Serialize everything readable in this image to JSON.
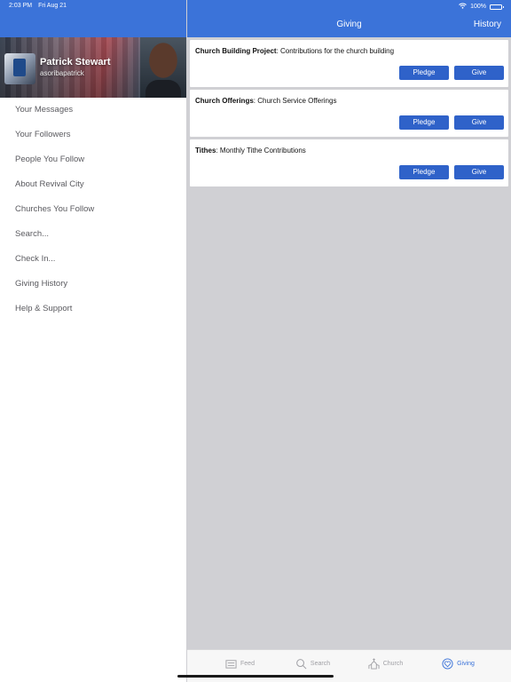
{
  "status_bar": {
    "time": "2:03 PM",
    "date": "Fri Aug 21",
    "battery": "100%"
  },
  "profile": {
    "name": "Patrick Stewart",
    "handle": "asoribapatrick"
  },
  "sidebar": {
    "items": [
      {
        "label": "Your Messages"
      },
      {
        "label": "Your Followers"
      },
      {
        "label": "People You Follow"
      },
      {
        "label": "About Revival City"
      },
      {
        "label": "Churches You Follow"
      },
      {
        "label": "Search..."
      },
      {
        "label": "Check In..."
      },
      {
        "label": "Giving History"
      },
      {
        "label": "Help & Support"
      }
    ]
  },
  "header": {
    "title": "Giving",
    "history_label": "History"
  },
  "funds": [
    {
      "name": "Church Building Project",
      "description": ": Contributions for the church building",
      "pledge_label": "Pledge",
      "give_label": "Give"
    },
    {
      "name": "Church Offerings",
      "description": ": Church Service Offerings",
      "pledge_label": "Pledge",
      "give_label": "Give"
    },
    {
      "name": "Tithes",
      "description": ": Monthly Tithe Contributions",
      "pledge_label": "Pledge",
      "give_label": "Give"
    }
  ],
  "tabs": [
    {
      "label": "Feed",
      "icon": "feed-icon"
    },
    {
      "label": "Search",
      "icon": "search-icon"
    },
    {
      "label": "Church",
      "icon": "church-icon"
    },
    {
      "label": "Giving",
      "icon": "giving-icon",
      "active": true
    }
  ],
  "colors": {
    "accent": "#3b73d9",
    "button": "#2f62c9",
    "background": "#d0d0d4"
  }
}
